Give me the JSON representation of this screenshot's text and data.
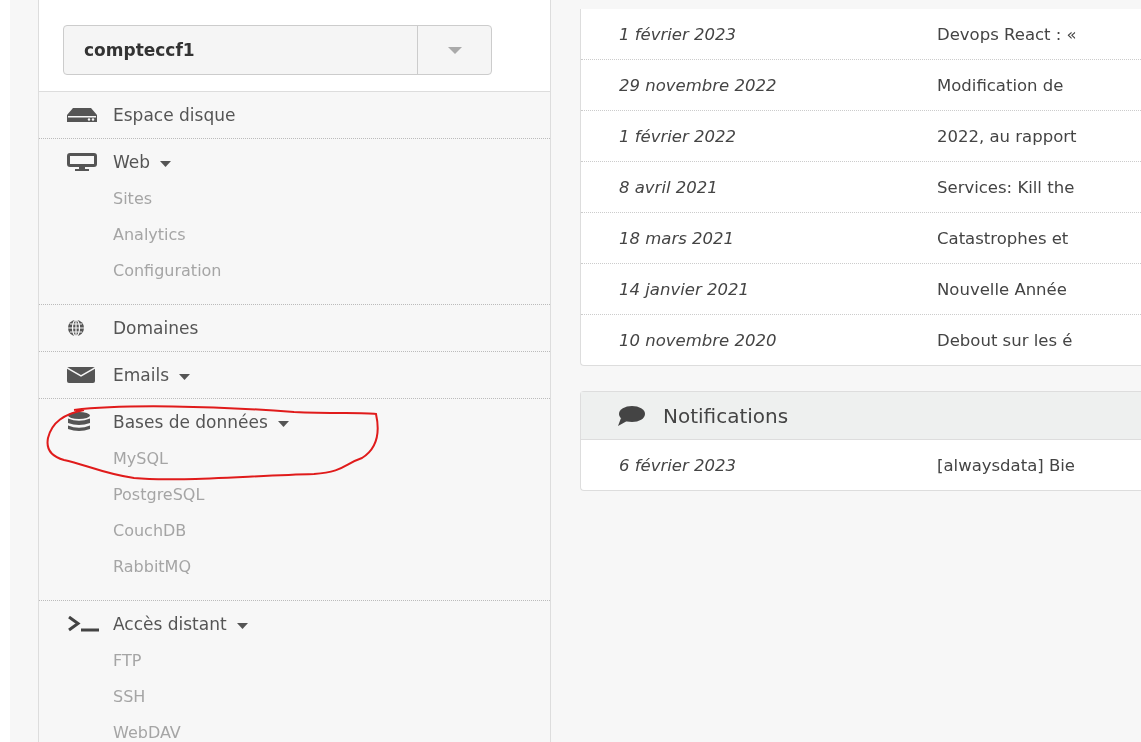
{
  "account_selector": {
    "value": "compteccf1"
  },
  "sidebar": {
    "sections": [
      {
        "label": "Espace disque",
        "expanded": false,
        "highlighted": false
      },
      {
        "label": "Web",
        "expanded": true,
        "highlighted": false,
        "children": [
          "Sites",
          "Analytics",
          "Configuration"
        ]
      },
      {
        "label": "Domaines",
        "expanded": false,
        "highlighted": false
      },
      {
        "label": "Emails",
        "expanded": true,
        "highlighted": false
      },
      {
        "label": "Bases de données",
        "expanded": true,
        "highlighted": true,
        "children": [
          "MySQL",
          "PostgreSQL",
          "CouchDB",
          "RabbitMQ"
        ]
      },
      {
        "label": "Accès distant",
        "expanded": true,
        "highlighted": false,
        "children": [
          "FTP",
          "SSH",
          "WebDAV"
        ]
      }
    ]
  },
  "news": {
    "rows": [
      {
        "date": "1 février 2023",
        "title": "Devops React : «"
      },
      {
        "date": "29 novembre 2022",
        "title": "Modification de"
      },
      {
        "date": "1 février 2022",
        "title": "2022, au rapport"
      },
      {
        "date": "8 avril 2021",
        "title": "Services: Kill the"
      },
      {
        "date": "18 mars 2021",
        "title": "Catastrophes et"
      },
      {
        "date": "14 janvier 2021",
        "title": "Nouvelle Année"
      },
      {
        "date": "10 novembre 2020",
        "title": "Debout sur les é"
      }
    ]
  },
  "notifications": {
    "title": "Notifications",
    "rows": [
      {
        "date": "6 février 2023",
        "title": "[alwaysdata] Bie"
      }
    ]
  }
}
